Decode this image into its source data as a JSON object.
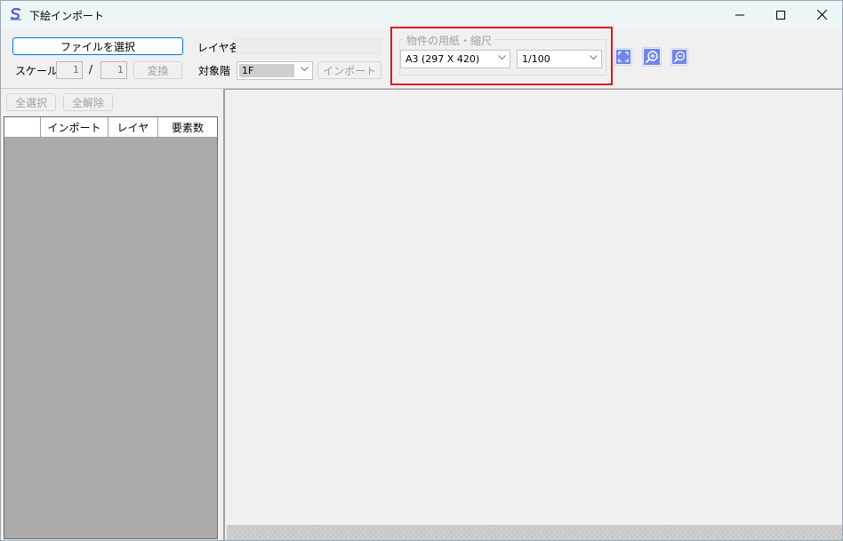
{
  "window": {
    "title": "下絵インポート",
    "controls": {
      "minimize": "minimize",
      "maximize": "maximize",
      "close": "close"
    }
  },
  "toolbar": {
    "select_file_label": "ファイルを選択",
    "layer_name_label": "レイヤ名",
    "layer_name_value": "",
    "scale_label": "スケール",
    "scale_numerator": "1",
    "scale_separator": "/",
    "scale_denominator": "1",
    "convert_label": "変換",
    "target_floor_label": "対象階",
    "target_floor_value": "1F",
    "import_label": "インポート"
  },
  "paper_group": {
    "title": "物件の用紙・縮尺",
    "paper_size_value": "A3 (297 X 420)",
    "scale_value": "1/100"
  },
  "view_tools": {
    "fit": "fit-to-window-icon",
    "zoom_in": "zoom-in-icon",
    "zoom_out": "zoom-out-icon"
  },
  "layer_panel": {
    "select_all_label": "全選択",
    "deselect_all_label": "全解除",
    "columns": [
      "",
      "インポート",
      "レイヤ",
      "要素数"
    ]
  },
  "colors": {
    "highlight": "#e0141e",
    "primary_border": "#0078d4",
    "grid_background": "#ababab"
  }
}
